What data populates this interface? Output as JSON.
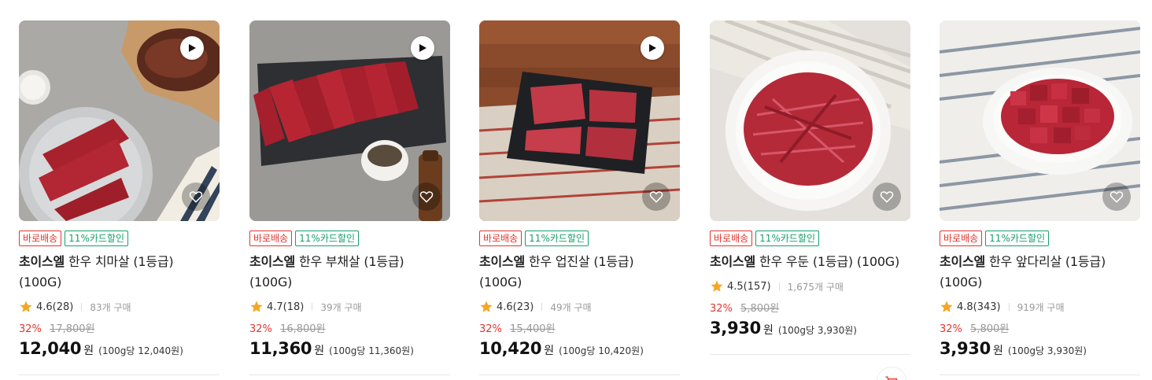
{
  "products": [
    {
      "badges": [
        "바로배송",
        "11%카드할인"
      ],
      "brand": "초이스엘",
      "name": "한우 치마살 (1등급) (100G)",
      "rating": "4.6(28)",
      "bought": "83개 구매",
      "discount": "32%",
      "original_price": "17,800원",
      "price": "12,040",
      "currency": "원",
      "unit_price": "(100g당 12,040원)",
      "has_video": true
    },
    {
      "badges": [
        "바로배송",
        "11%카드할인"
      ],
      "brand": "초이스엘",
      "name": "한우 부채살 (1등급) (100G)",
      "rating": "4.7(18)",
      "bought": "39개 구매",
      "discount": "32%",
      "original_price": "16,800원",
      "price": "11,360",
      "currency": "원",
      "unit_price": "(100g당 11,360원)",
      "has_video": true
    },
    {
      "badges": [
        "바로배송",
        "11%카드할인"
      ],
      "brand": "초이스엘",
      "name": "한우 업진살 (1등급) (100G)",
      "rating": "4.6(23)",
      "bought": "49개 구매",
      "discount": "32%",
      "original_price": "15,400원",
      "price": "10,420",
      "currency": "원",
      "unit_price": "(100g당 10,420원)",
      "has_video": true
    },
    {
      "badges": [
        "바로배송",
        "11%카드할인"
      ],
      "brand": "초이스엘",
      "name": "한우 우둔 (1등급) (100G)",
      "rating": "4.5(157)",
      "bought": "1,675개 구매",
      "discount": "32%",
      "original_price": "5,800원",
      "price": "3,930",
      "currency": "원",
      "unit_price": "(100g당 3,930원)",
      "has_video": false
    },
    {
      "badges": [
        "바로배송",
        "11%카드할인"
      ],
      "brand": "초이스엘",
      "name": "한우 앞다리살 (1등급) (100G)",
      "rating": "4.8(343)",
      "bought": "919개 구매",
      "discount": "32%",
      "original_price": "5,800원",
      "price": "3,930",
      "currency": "원",
      "unit_price": "(100g당 3,930원)",
      "has_video": false
    }
  ],
  "icons": {
    "play": "play-icon",
    "heart": "heart-icon",
    "star": "star-icon",
    "cart": "cart-icon"
  },
  "colors": {
    "accent_red": "#e2362f",
    "accent_green": "#15a16a",
    "star": "#f5a623"
  }
}
